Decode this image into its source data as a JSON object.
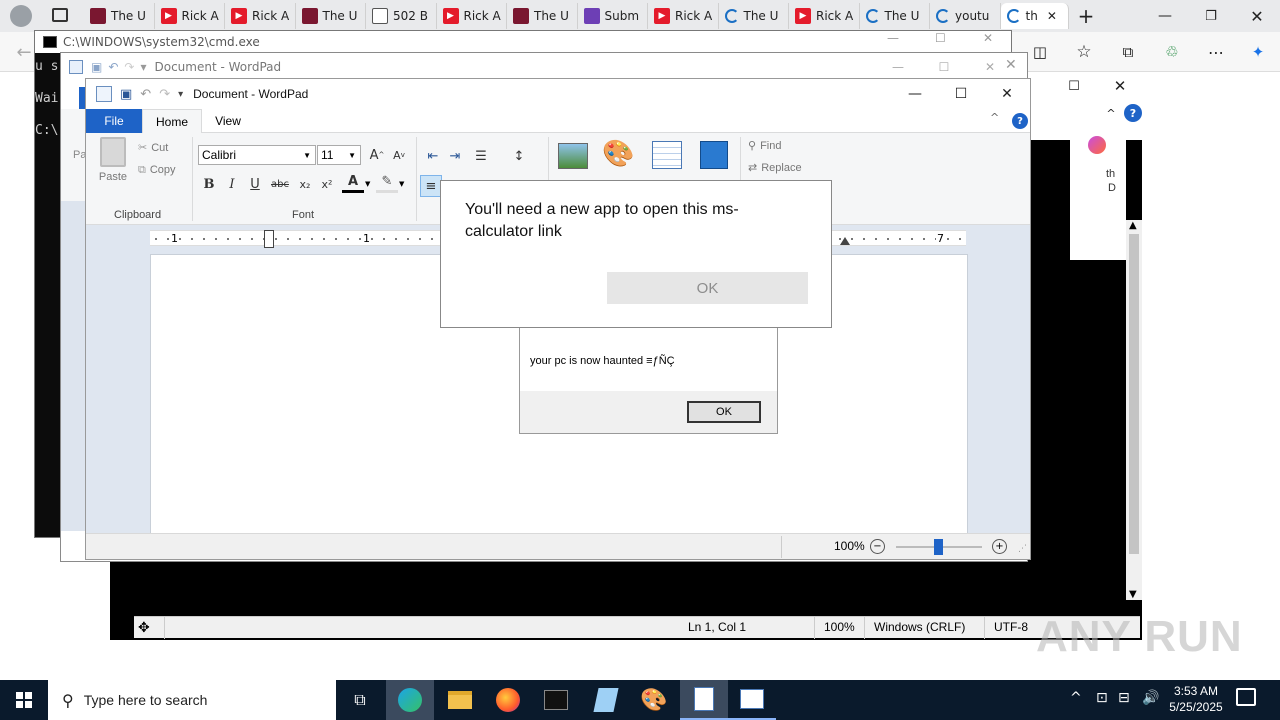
{
  "browser": {
    "tabs": [
      {
        "label": "The U",
        "color": "#7a1730",
        "icon": "app-icon"
      },
      {
        "label": "Rick A",
        "color": "#e41b2b",
        "icon": "youtube-icon"
      },
      {
        "label": "Rick A",
        "color": "#e41b2b",
        "icon": "youtube-icon"
      },
      {
        "label": "The U",
        "color": "#7a1730",
        "icon": "app-icon"
      },
      {
        "label": "502 B",
        "color": "#555555",
        "icon": "page-icon"
      },
      {
        "label": "Rick A",
        "color": "#e41b2b",
        "icon": "youtube-icon"
      },
      {
        "label": "The U",
        "color": "#7a1730",
        "icon": "app-icon"
      },
      {
        "label": "Subm",
        "color": "#6d3fb5",
        "icon": "form-icon"
      },
      {
        "label": "Rick A",
        "color": "#e41b2b",
        "icon": "youtube-icon"
      },
      {
        "label": "The U",
        "color": "#1a6fc4",
        "icon": "loading-icon"
      },
      {
        "label": "Rick A",
        "color": "#e41b2b",
        "icon": "youtube-icon"
      },
      {
        "label": "The U",
        "color": "#1a6fc4",
        "icon": "loading-icon"
      },
      {
        "label": "youtu",
        "color": "#1a6fc4",
        "icon": "loading-icon"
      },
      {
        "label": "th",
        "color": "#1a6fc4",
        "icon": "loading-icon"
      }
    ]
  },
  "cmd": {
    "title": "C:\\WINDOWS\\system32\\cmd.exe",
    "lines": [
      "u s",
      "Wai",
      "C:\\"
    ]
  },
  "wordpad_back": {
    "title": "Document - WordPad",
    "side_text": [
      "Pa"
    ]
  },
  "wordpad": {
    "title": "Document - WordPad",
    "tabs": [
      "File",
      "Home",
      "View"
    ],
    "clipboard": {
      "paste": "Paste",
      "cut": "Cut",
      "copy": "Copy",
      "group": "Clipboard"
    },
    "font": {
      "name": "Calibri",
      "size": "11",
      "group": "Font"
    },
    "editing": {
      "find": "Find",
      "replace": "Replace"
    },
    "zoom": "100%",
    "ruler_numbers": [
      "1",
      "1",
      "7"
    ]
  },
  "notepad_status": {
    "position": "Ln 1, Col 1",
    "zoom": "100%",
    "line_ending": "Windows (CRLF)",
    "encoding": "UTF-8"
  },
  "notepad_side": {
    "text": [
      "th",
      "D"
    ]
  },
  "msgbox": {
    "message": "your pc is now haunted ≡ƒÑÇ",
    "ok": "OK"
  },
  "app_dialog": {
    "message": "You'll need a new app to open this ms-calculator link",
    "ok": "OK"
  },
  "taskbar": {
    "search_placeholder": "Type here to search",
    "time": "3:53 AM",
    "date": "5/25/2025"
  },
  "watermark": "ANY RUN"
}
